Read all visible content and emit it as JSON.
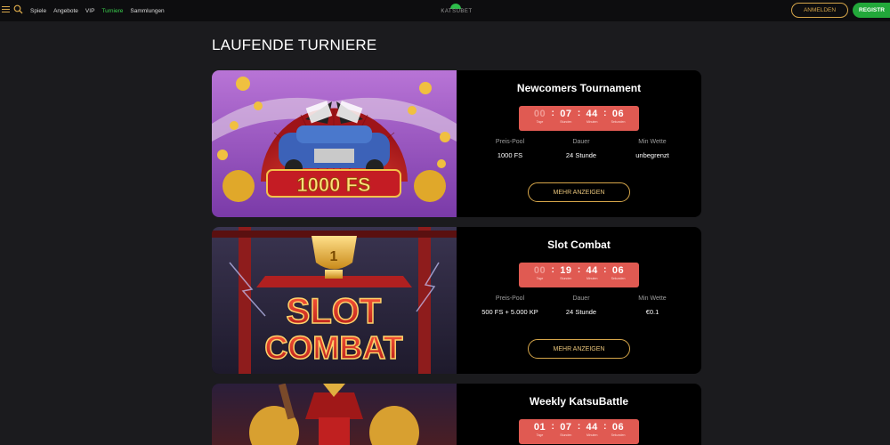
{
  "nav": {
    "items": [
      {
        "label": "Spiele",
        "active": false
      },
      {
        "label": "Angebote",
        "active": false
      },
      {
        "label": "VIP",
        "active": false
      },
      {
        "label": "Turniere",
        "active": true
      },
      {
        "label": "Sammlungen",
        "active": false
      }
    ],
    "logo_text": "KATSUBET",
    "login_label": "ANMELDEN",
    "register_label": "REGISTR"
  },
  "colors": {
    "accent_gold": "#d6a64a",
    "accent_green": "#22a83a",
    "timer_red": "#e05a52"
  },
  "page_title": "LAUFENDE TURNIERE",
  "tournaments": [
    {
      "title": "Newcomers Tournament",
      "image_text": "1000 FS",
      "timer": {
        "days": "00",
        "hours": "07",
        "minutes": "44",
        "seconds": "06",
        "labels": [
          "Tage",
          "Stunden",
          "Minuten",
          "Sekunden"
        ]
      },
      "stats": [
        {
          "label": "Preis-Pool",
          "value": "1000 FS"
        },
        {
          "label": "Dauer",
          "value": "24 Stunde"
        },
        {
          "label": "Min Wette",
          "value": "unbegrenzt"
        }
      ],
      "button": "MEHR ANZEIGEN"
    },
    {
      "title": "Slot Combat",
      "image_text": [
        "SLOT",
        "COMBAT"
      ],
      "timer": {
        "days": "00",
        "hours": "19",
        "minutes": "44",
        "seconds": "06",
        "labels": [
          "Tage",
          "Stunden",
          "Minuten",
          "Sekunden"
        ]
      },
      "stats": [
        {
          "label": "Preis-Pool",
          "value": "500 FS + 5.000 KP"
        },
        {
          "label": "Dauer",
          "value": "24 Stunde"
        },
        {
          "label": "Min Wette",
          "value": "€0.1"
        }
      ],
      "button": "MEHR ANZEIGEN"
    },
    {
      "title": "Weekly KatsuBattle",
      "timer": {
        "days": "01",
        "hours": "07",
        "minutes": "44",
        "seconds": "06",
        "labels": [
          "Tage",
          "Stunden",
          "Minuten",
          "Sekunden"
        ]
      }
    }
  ]
}
